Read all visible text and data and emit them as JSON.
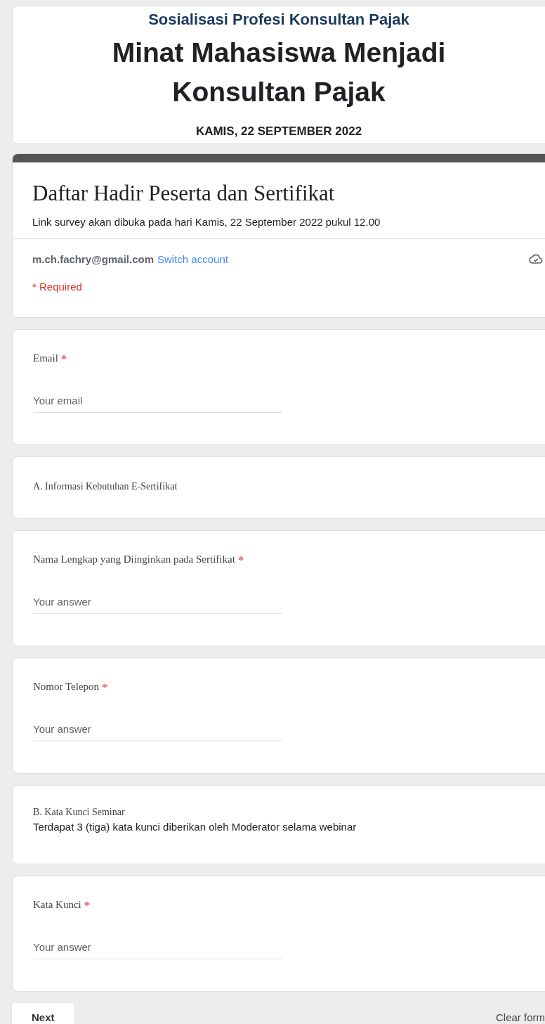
{
  "header": {
    "subtitle": "Sosialisasi Profesi Konsultan Pajak",
    "title": "Minat Mahasiswa Menjadi Konsultan Pajak",
    "date": "KAMIS, 22 SEPTEMBER 2022"
  },
  "form": {
    "title": "Daftar Hadir Peserta dan Sertifikat",
    "description": "Link survey akan dibuka pada hari Kamis, 22 September 2022 pukul 12.00",
    "account": "m.ch.fachry@gmail.com",
    "switch_account": "Switch account",
    "required_note": "* Required"
  },
  "items": [
    {
      "kind": "question",
      "title": "Email",
      "required_mark": "*",
      "placeholder": "Your email"
    },
    {
      "kind": "section",
      "title": "A. Informasi Kebutuhan E-Sertifikat"
    },
    {
      "kind": "question",
      "title": "Nama Lengkap yang Diinginkan pada Sertifikat",
      "required_mark": "*",
      "placeholder": "Your answer"
    },
    {
      "kind": "question",
      "title": "Nomor Telepon",
      "required_mark": "*",
      "placeholder": "Your answer"
    },
    {
      "kind": "section",
      "title": "B. Kata Kunci Seminar",
      "description": "Terdapat 3 (tiga) kata kunci diberikan oleh Moderator selama webinar"
    },
    {
      "kind": "question",
      "title": "Kata Kunci",
      "required_mark": "*",
      "placeholder": "Your answer"
    }
  ],
  "footer": {
    "next": "Next",
    "clear": "Clear form"
  }
}
